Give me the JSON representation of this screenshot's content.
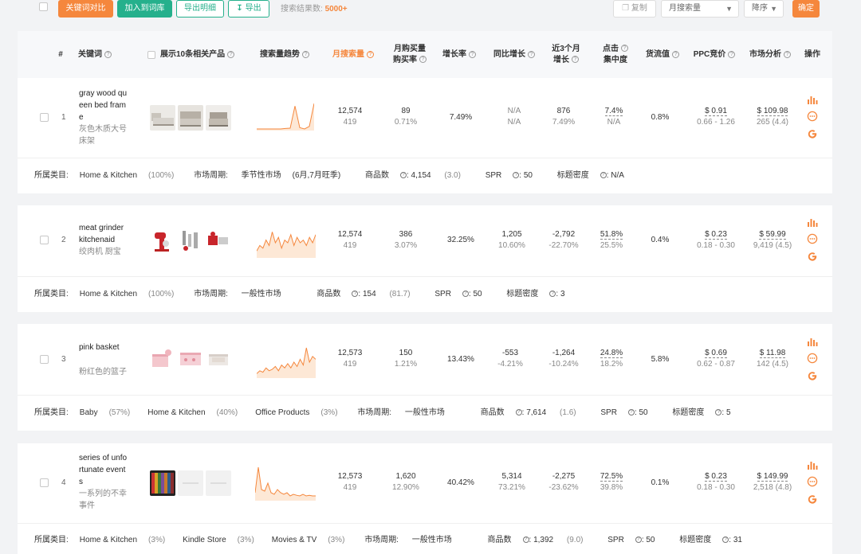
{
  "toolbar": {
    "compare_label": "关键词对比",
    "add_library_label": "加入到词库",
    "export_detail_label": "导出明细",
    "export_label": "导出",
    "result_label": "搜索结果数:",
    "result_count": "5000+",
    "copy_label": "复制",
    "sort_field": "月搜索量",
    "sort_order": "降序",
    "confirm_label": "确定"
  },
  "header": {
    "index": "#",
    "keyword": "关键词",
    "show_products": "展示10条相关产品",
    "trend": "搜索量趋势",
    "monthly_search": "月搜索量",
    "purchase_line1": "月购买量",
    "purchase_line2": "购买率",
    "growth": "增长率",
    "yoy": "同比增长",
    "recent3_line1": "近3个月",
    "recent3_line2": "增长",
    "click_line1": "点击",
    "click_line2": "集中度",
    "flow": "货流值",
    "ppc": "PPC竞价",
    "market": "市场分析",
    "ops": "操作"
  },
  "colors": {
    "accent_orange": "#f5873d",
    "accent_green": "#25b08c",
    "google_orange": "#f5873d"
  },
  "rows": [
    {
      "index": "1",
      "keyword_lines": [
        "gray wood qu",
        "een bed fram",
        "e"
      ],
      "keyword_cn_lines": [
        "灰色木质大号",
        "床架"
      ],
      "monthly_search": "12,574",
      "monthly_search_sub": "419",
      "purchase": "89",
      "purchase_rate": "0.71%",
      "growth": "7.49%",
      "yoy": "N/A",
      "yoy_sub": "N/A",
      "recent3": "876",
      "recent3_sub": "7.49%",
      "click": "7.4%",
      "click_sub": "N/A",
      "flow": "0.8%",
      "ppc": "$ 0.91",
      "ppc_range": "0.66 - 1.26",
      "market_price": "$ 109.98",
      "market_sub": "265 (4.4)",
      "trend": [
        0,
        0,
        0,
        0,
        0,
        0,
        0.02,
        0.03,
        0.9,
        0.05,
        0.0,
        0.1,
        1.0
      ],
      "footer": {
        "category_label": "所属类目:",
        "categories": [
          {
            "name": "Home & Kitchen",
            "pct": "(100%)"
          }
        ],
        "cycle_label": "市场周期:",
        "cycle": "季节性市场",
        "cycle_extra": "(6月,7月旺季)",
        "products_label": "商品数",
        "products": "4,154",
        "products_extra": "(3.0)",
        "spr_label": "SPR",
        "spr": "50",
        "density_label": "标题密度",
        "density": "N/A"
      }
    },
    {
      "index": "2",
      "keyword_lines": [
        "meat grinder",
        "kitchenaid"
      ],
      "keyword_cn_lines": [
        "绞肉机 厨宝"
      ],
      "monthly_search": "12,574",
      "monthly_search_sub": "419",
      "purchase": "386",
      "purchase_rate": "3.07%",
      "growth": "32.25%",
      "yoy": "1,205",
      "yoy_sub": "10.60%",
      "recent3": "-2,792",
      "recent3_sub": "-22.70%",
      "click": "51.8%",
      "click_sub": "25.5%",
      "flow": "0.4%",
      "ppc": "$ 0.23",
      "ppc_range": "0.18 - 0.30",
      "market_price": "$ 59.99",
      "market_sub": "9,419 (4.5)",
      "trend": [
        0.2,
        0.4,
        0.3,
        0.6,
        0.4,
        0.9,
        0.5,
        0.7,
        0.3,
        0.6,
        0.5,
        0.8,
        0.4,
        0.7,
        0.5,
        0.6,
        0.4,
        0.7,
        0.5,
        0.8
      ],
      "footer": {
        "category_label": "所属类目:",
        "categories": [
          {
            "name": "Home & Kitchen",
            "pct": "(100%)"
          }
        ],
        "cycle_label": "市场周期:",
        "cycle": "一般性市场",
        "cycle_extra": "",
        "products_label": "商品数",
        "products": "154",
        "products_extra": "(81.7)",
        "spr_label": "SPR",
        "spr": "50",
        "density_label": "标题密度",
        "density": "3"
      }
    },
    {
      "index": "3",
      "keyword_lines": [
        "pink basket"
      ],
      "keyword_cn_lines": [
        "粉红色的篮子"
      ],
      "monthly_search": "12,573",
      "monthly_search_sub": "419",
      "purchase": "150",
      "purchase_rate": "1.21%",
      "growth": "13.43%",
      "yoy": "-553",
      "yoy_sub": "-4.21%",
      "recent3": "-1,264",
      "recent3_sub": "-10.24%",
      "click": "24.8%",
      "click_sub": "18.2%",
      "flow": "5.8%",
      "ppc": "$ 0.69",
      "ppc_range": "0.62 - 0.87",
      "market_price": "$ 11.98",
      "market_sub": "142 (4.5)",
      "trend": [
        0.1,
        0.2,
        0.15,
        0.3,
        0.2,
        0.25,
        0.35,
        0.2,
        0.4,
        0.3,
        0.45,
        0.3,
        0.5,
        0.35,
        0.6,
        0.4,
        1.0,
        0.5,
        0.7,
        0.6
      ],
      "footer": {
        "category_label": "所属类目:",
        "categories": [
          {
            "name": "Baby",
            "pct": "(57%)"
          },
          {
            "name": "Home & Kitchen",
            "pct": "(40%)"
          },
          {
            "name": "Office Products",
            "pct": "(3%)"
          }
        ],
        "cycle_label": "市场周期:",
        "cycle": "一般性市场",
        "cycle_extra": "",
        "products_label": "商品数",
        "products": "7,614",
        "products_extra": "(1.6)",
        "spr_label": "SPR",
        "spr": "50",
        "density_label": "标题密度",
        "density": "5"
      }
    },
    {
      "index": "4",
      "keyword_lines": [
        "series of unfo",
        "rtunate event",
        "s"
      ],
      "keyword_cn_lines": [
        "一系列的不幸",
        "事件"
      ],
      "monthly_search": "12,573",
      "monthly_search_sub": "419",
      "purchase": "1,620",
      "purchase_rate": "12.90%",
      "growth": "40.42%",
      "yoy": "5,314",
      "yoy_sub": "73.21%",
      "recent3": "-2,275",
      "recent3_sub": "-23.62%",
      "click": "72.5%",
      "click_sub": "39.8%",
      "flow": "0.1%",
      "ppc": "$ 0.23",
      "ppc_range": "0.18 - 0.30",
      "market_price": "$ 149.99",
      "market_sub": "2,518 (4.8)",
      "trend": [
        0.2,
        1.0,
        0.3,
        0.25,
        0.5,
        0.2,
        0.15,
        0.3,
        0.2,
        0.15,
        0.2,
        0.1,
        0.15,
        0.12,
        0.1,
        0.15,
        0.1,
        0.12,
        0.1,
        0.1
      ],
      "footer": {
        "category_label": "所属类目:",
        "categories": [
          {
            "name": "Home & Kitchen",
            "pct": "(3%)"
          },
          {
            "name": "Kindle Store",
            "pct": "(3%)"
          },
          {
            "name": "Movies & TV",
            "pct": "(3%)"
          }
        ],
        "cycle_label": "市场周期:",
        "cycle": "一般性市场",
        "cycle_extra": "",
        "products_label": "商品数",
        "products": "1,392",
        "products_extra": "(9.0)",
        "spr_label": "SPR",
        "spr": "50",
        "density_label": "标题密度",
        "density": "31"
      }
    }
  ]
}
